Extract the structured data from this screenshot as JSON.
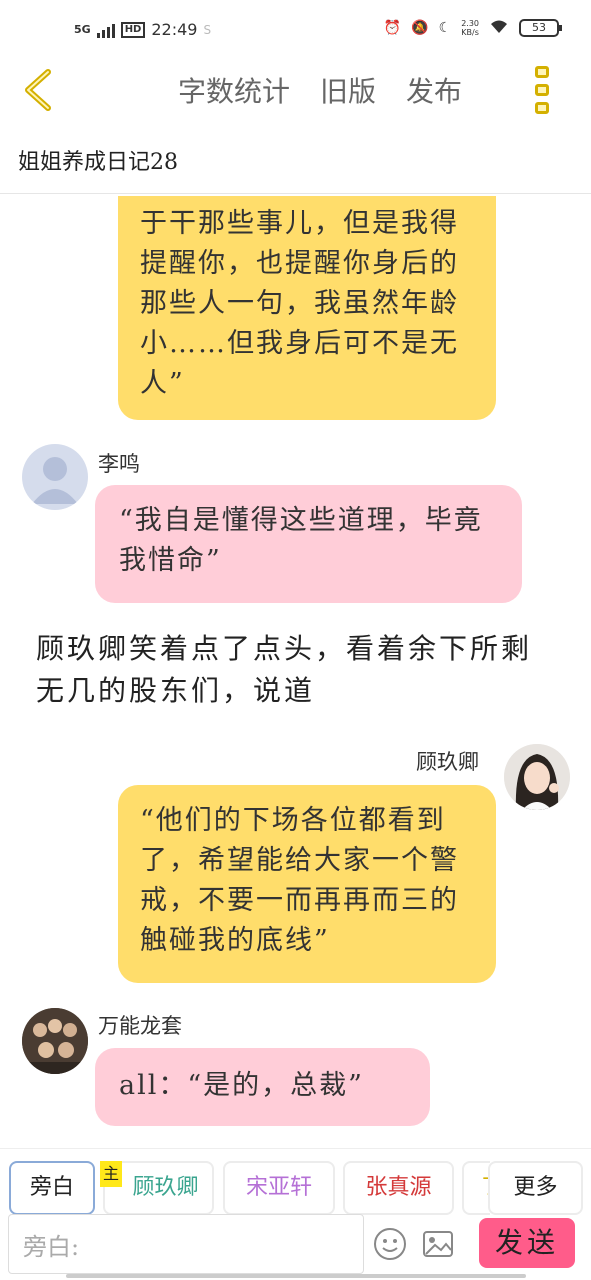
{
  "status_bar": {
    "network": "5G",
    "hd": "HD",
    "time": "22:49",
    "net_speed_value": "2.30",
    "net_speed_unit": "KB/s",
    "battery": "53"
  },
  "header": {
    "word_count": "字数统计",
    "old_version": "旧版",
    "publish": "发布"
  },
  "story_title": "姐姐养成日记28",
  "messages": {
    "m1_text": "于干那些事儿，但是我得提醒你，也提醒你身后的那些人一句，我虽然年龄小……但我身后可不是无人”",
    "m2_name": "李鸣",
    "m2_text": "“我自是懂得这些道理，毕竟我惜命”",
    "m3_narration": "顾玖卿笑着点了点头，看着余下所剩无几的股东们，说道",
    "m4_name": "顾玖卿",
    "m4_text": "“他们的下场各位都看到了，希望能给大家一个警戒，不要一而再再而三的触碰我的底线”",
    "m5_name": "万能龙套",
    "m5_text": "all：“是的，总裁”"
  },
  "characters": {
    "narrator": "旁白",
    "main_tag": "主",
    "c1": "顾玖卿",
    "c2": "宋亚轩",
    "c3": "张真源",
    "c4_partial": "丁",
    "more": "更多"
  },
  "input": {
    "placeholder": "旁白:",
    "send": "发送"
  },
  "colors": {
    "yellow_bubble": "#ffdd6b",
    "pink_bubble": "#ffcdd8",
    "send_button": "#ff5c8a",
    "accent_yellow": "#d4b000",
    "c1_color": "#3aa58f",
    "c2_color": "#b570d6",
    "c3_color": "#d43a3a"
  }
}
